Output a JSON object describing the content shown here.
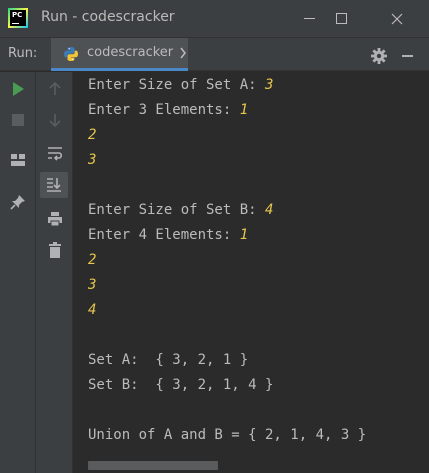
{
  "window": {
    "title": "Run - codescracker",
    "logo_text": "PC"
  },
  "runbar": {
    "label": "Run:",
    "tab_label": "codescracker"
  },
  "toolbar": {
    "left_column": [
      "run-icon",
      "stop-icon",
      "layout-icon",
      "pin-icon"
    ],
    "right_column": [
      "scroll-up-icon",
      "scroll-down-icon",
      "soft-wrap-icon",
      "scroll-to-end-icon",
      "print-icon",
      "trash-icon"
    ]
  },
  "console": {
    "lines": [
      {
        "text": "Enter Size of Set A: ",
        "input": "3"
      },
      {
        "text": "Enter 3 Elements: ",
        "input": "1"
      },
      {
        "text": "",
        "input": "2"
      },
      {
        "text": "",
        "input": "3"
      },
      {
        "text": "",
        "input": ""
      },
      {
        "text": "Enter Size of Set B: ",
        "input": "4"
      },
      {
        "text": "Enter 4 Elements: ",
        "input": "1"
      },
      {
        "text": "",
        "input": "2"
      },
      {
        "text": "",
        "input": "3"
      },
      {
        "text": "",
        "input": "4"
      },
      {
        "text": "",
        "input": ""
      },
      {
        "text": "Set A:  { 3, 2, 1 }",
        "input": ""
      },
      {
        "text": "Set B:  { 3, 2, 1, 4 }",
        "input": ""
      },
      {
        "text": "",
        "input": ""
      },
      {
        "text": "Union of A and B = { 2, 1, 4, 3 }",
        "input": ""
      }
    ]
  },
  "colors": {
    "background": "#2b2b2b",
    "chrome": "#3c3f41",
    "text": "#bbbbbb",
    "user_input": "#e6c64c",
    "run_green": "#499c54",
    "tab_accent": "#4a88c7"
  }
}
